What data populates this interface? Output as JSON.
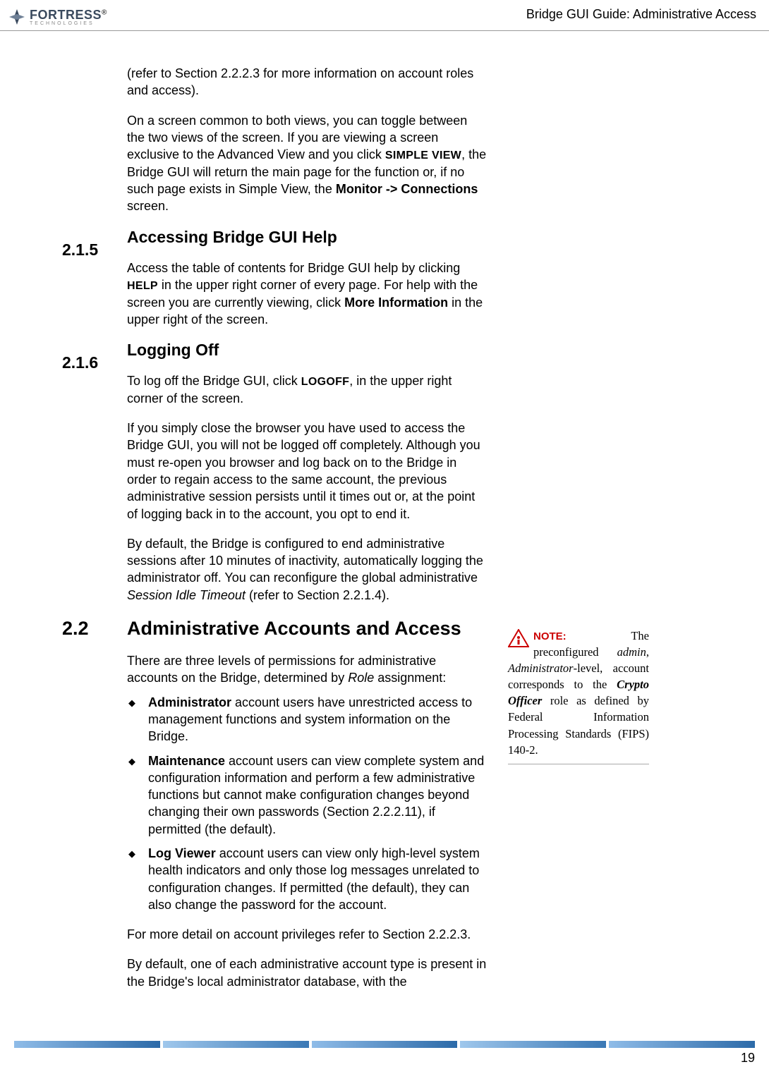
{
  "header": {
    "logo_main": "FORTRESS",
    "logo_sub": "TECHNOLOGIES",
    "title": "Bridge GUI Guide: Administrative Access"
  },
  "p1_a": "(refer to Section 2.2.2.3 for more information on account roles and access).",
  "p2_a": "On a screen common to both views, you can toggle between the two views of the screen. If you are viewing a screen exclusive to the Advanced View and you click ",
  "p2_b": "SIMPLE VIEW",
  "p2_c": ", the Bridge GUI will return the main page for the function or, if no such page exists in Simple View, the ",
  "p2_d": "Monitor -> Connections",
  "p2_e": " screen.",
  "s215_num": "2.1.5",
  "s215_title": "Accessing Bridge GUI Help",
  "s215_p1a": "Access the table of contents for Bridge GUI help by clicking ",
  "s215_p1b": "HELP",
  "s215_p1c": " in the upper right corner of every page. For help with the screen you are currently viewing, click ",
  "s215_p1d": "More Information",
  "s215_p1e": " in the upper right of the screen.",
  "s216_num": "2.1.6",
  "s216_title": "Logging Off",
  "s216_p1a": "To log off the Bridge GUI, click ",
  "s216_p1b": "LOGOFF",
  "s216_p1c": ", in the upper right corner of the screen.",
  "s216_p2": "If you simply close the browser you have used to access the Bridge GUI, you will not be logged off completely. Although you must re-open you browser and log back on to the Bridge in order to regain access to the same account, the previous administrative session persists until it times out or, at the point of logging back in to the account, you opt to end it.",
  "s216_p3a": "By default, the Bridge is configured to end administrative sessions after 10 minutes of inactivity, automatically logging the administrator off. You can reconfigure the global administrative ",
  "s216_p3b": "Session Idle Timeout",
  "s216_p3c": " (refer to Section 2.2.1.4).",
  "s22_num": "2.2",
  "s22_title": "Administrative Accounts and Access",
  "s22_p1a": "There are three levels of permissions for administrative accounts on the Bridge, determined by ",
  "s22_p1b": "Role",
  "s22_p1c": " assignment:",
  "bul1_a": "Administrator",
  "bul1_b": " account users have unrestricted access to management functions and system information on the Bridge.",
  "bul2_a": "Maintenance",
  "bul2_b": " account users can view complete system and configuration information and perform a few administrative functions but cannot make configuration changes beyond changing their own passwords (Section 2.2.2.11), if permitted (the default).",
  "bul3_a": "Log Viewer",
  "bul3_b": " account users can view only high-level system health indicators and only those log messages unrelated to configuration changes. If permitted (the default), they can also change the password for the account.",
  "s22_p2": "For more detail on account privileges refer to Section 2.2.2.3.",
  "s22_p3": "By default, one of each administrative account type is present in the Bridge's local administrator database, with the",
  "note_label": "NOTE:",
  "note_a": " The preconfigured ",
  "note_b": "admin",
  "note_c": ", ",
  "note_d": "Administrator",
  "note_e": "-level, account corresponds to the ",
  "note_f": "Crypto Officer",
  "note_g": " role as defined by Federal Information Processing Standards (FIPS) 140-2.",
  "page_num": "19"
}
